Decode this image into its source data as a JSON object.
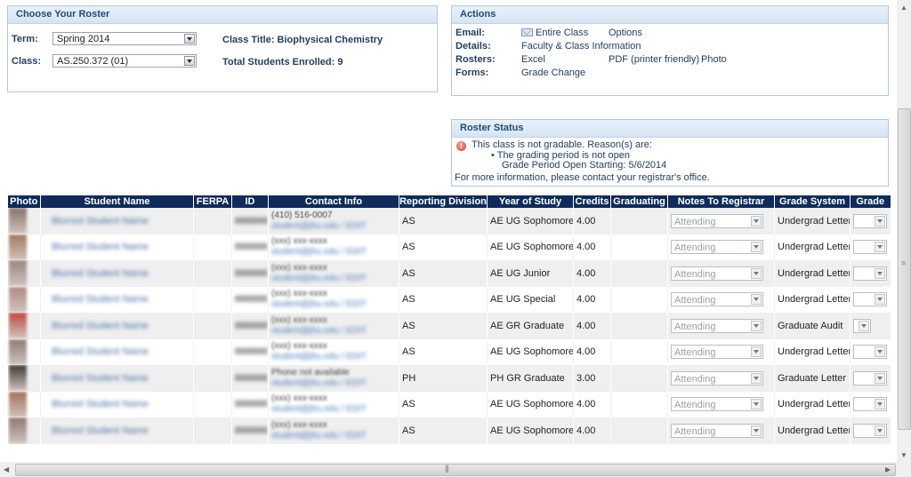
{
  "roster": {
    "title": "Choose Your Roster",
    "term_label": "Term:",
    "term_value": "Spring 2014",
    "class_label": "Class:",
    "class_value": "AS.250.372 (01)",
    "class_title": "Class Title: Biophysical Chemistry",
    "total_enrolled": "Total Students Enrolled: 9"
  },
  "actions": {
    "title": "Actions",
    "email_label": "Email:",
    "email_entire_class": "Entire Class",
    "email_options": "Options",
    "details_label": "Details:",
    "details_link": "Faculty & Class Information",
    "rosters_label": "Rosters:",
    "rosters_excel": "Excel",
    "rosters_pdf": "PDF (printer friendly)",
    "rosters_photo": "Photo",
    "forms_label": "Forms:",
    "forms_grade_change": "Grade Change"
  },
  "status": {
    "title": "Roster Status",
    "icon": "warning-icon",
    "message": "This class is not gradable. Reason(s) are:",
    "reason": "The grading period is not open",
    "period_open": "Grade Period Open Starting: 5/6/2014",
    "contact": "For more information, please contact your registrar's office."
  },
  "table": {
    "headers": [
      "Photo",
      "Student Name",
      "FERPA",
      "ID",
      "Contact Info",
      "Reporting Division",
      "Year of Study",
      "Credits",
      "Graduating",
      "Notes To Registrar",
      "Grade System",
      "Grade"
    ],
    "rows": [
      {
        "name": "Blurred Student Name",
        "id": "000000",
        "phone": "(410) 516-0007",
        "email": "student@jhu.edu / EDIT",
        "division": "AS",
        "year": "AE UG Sophomore",
        "credits": "4.00",
        "graduating": "",
        "notes": "Attending",
        "grade_system": "Undergrad Letter",
        "grade": ""
      },
      {
        "name": "Blurred Student Name",
        "id": "000000",
        "phone": "(xxx) xxx-xxxx",
        "email": "student@jhu.edu / EDIT",
        "division": "AS",
        "year": "AE UG Sophomore",
        "credits": "4.00",
        "graduating": "",
        "notes": "Attending",
        "grade_system": "Undergrad Letter",
        "grade": ""
      },
      {
        "name": "Blurred Student Name",
        "id": "000000",
        "phone": "(xxx) xxx-xxxx",
        "email": "student@jhu.edu / EDIT",
        "division": "AS",
        "year": "AE UG Junior",
        "credits": "4.00",
        "graduating": "",
        "notes": "Attending",
        "grade_system": "Undergrad Letter",
        "grade": ""
      },
      {
        "name": "Blurred Student Name",
        "id": "000000",
        "phone": "(xxx) xxx-xxxx",
        "email": "student@jhu.edu / EDIT",
        "division": "AS",
        "year": "AE UG Special",
        "credits": "4.00",
        "graduating": "",
        "notes": "Attending",
        "grade_system": "Undergrad Letter",
        "grade": ""
      },
      {
        "name": "Blurred Student Name",
        "id": "000000",
        "phone": "(xxx) xxx-xxxx",
        "email": "student@jhu.edu / EDIT",
        "division": "AS",
        "year": "AE GR Graduate",
        "credits": "4.00",
        "graduating": "",
        "notes": "Attending",
        "grade_system": "Graduate Audit",
        "grade": ""
      },
      {
        "name": "Blurred Student Name",
        "id": "000000",
        "phone": "(xxx) xxx-xxxx",
        "email": "student@jhu.edu / EDIT",
        "division": "AS",
        "year": "AE UG Sophomore",
        "credits": "4.00",
        "graduating": "",
        "notes": "Attending",
        "grade_system": "Undergrad Letter",
        "grade": ""
      },
      {
        "name": "Blurred Student Name",
        "id": "000000",
        "phone": "Phone not available",
        "email": "student@jhu.edu / EDIT",
        "division": "PH",
        "year": "PH GR Graduate",
        "credits": "3.00",
        "graduating": "",
        "notes": "Attending",
        "grade_system": "Graduate Letter",
        "grade": ""
      },
      {
        "name": "Blurred Student Name",
        "id": "000000",
        "phone": "(xxx) xxx-xxxx",
        "email": "student@jhu.edu / EDIT",
        "division": "AS",
        "year": "AE UG Sophomore",
        "credits": "4.00",
        "graduating": "",
        "notes": "Attending",
        "grade_system": "Undergrad Letter",
        "grade": ""
      },
      {
        "name": "Blurred Student Name",
        "id": "000000",
        "phone": "(xxx) xxx-xxxx",
        "email": "student@jhu.edu / EDIT",
        "division": "AS",
        "year": "AE UG Sophomore",
        "credits": "4.00",
        "graduating": "",
        "notes": "Attending",
        "grade_system": "Undergrad Letter",
        "grade": ""
      }
    ]
  },
  "colors": {
    "header_bg": "#0f2b5b",
    "panel_title": "#1f4a7a",
    "link": "#233e62",
    "row_alt": "#efefef"
  },
  "photo_colors": [
    "#8a6f68",
    "#a07a5c",
    "#9a8580",
    "#b08a82",
    "#c0483e",
    "#8e7c72",
    "#3e3a36",
    "#a5705a",
    "#8f7a70"
  ]
}
